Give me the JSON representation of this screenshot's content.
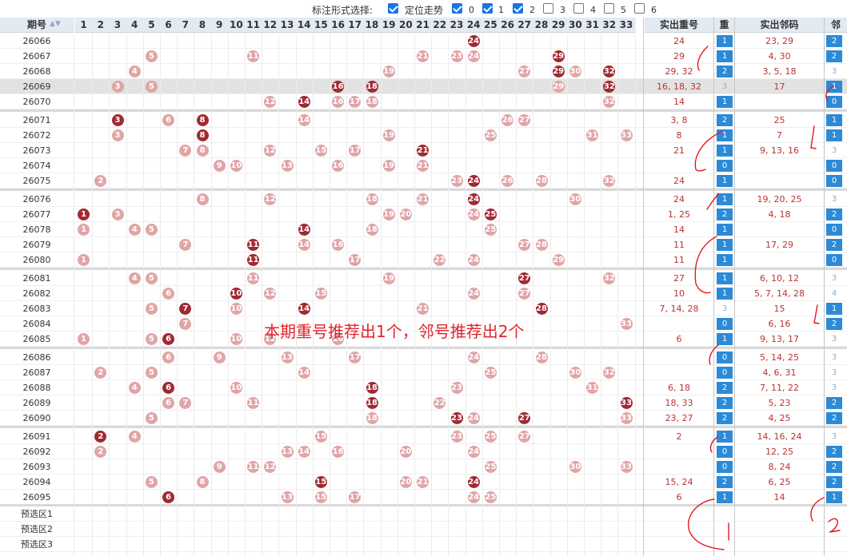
{
  "options": {
    "label": "标注形式选择:",
    "items": [
      {
        "label": "定位走势",
        "checked": true
      },
      {
        "label": "0",
        "checked": true
      },
      {
        "label": "1",
        "checked": true
      },
      {
        "label": "2",
        "checked": true
      },
      {
        "label": "3",
        "checked": false
      },
      {
        "label": "4",
        "checked": false
      },
      {
        "label": "5",
        "checked": false
      },
      {
        "label": "6",
        "checked": false
      }
    ]
  },
  "table": {
    "headers": {
      "period": "期号",
      "repeat_nums": "实出重号",
      "repeat": "重",
      "neighbor_nums": "实出邻码",
      "neighbor": "邻"
    },
    "numbers": [
      "1",
      "2",
      "3",
      "4",
      "5",
      "6",
      "7",
      "8",
      "9",
      "10",
      "11",
      "12",
      "13",
      "14",
      "15",
      "16",
      "17",
      "18",
      "19",
      "20",
      "21",
      "22",
      "23",
      "24",
      "25",
      "26",
      "27",
      "28",
      "29",
      "30",
      "31",
      "32",
      "33"
    ],
    "rows": [
      {
        "period": "26066",
        "dark": [
          24
        ],
        "light": [],
        "rep": "24",
        "r": "1",
        "rh": true,
        "nb": "23, 29",
        "n": "2",
        "nh": true
      },
      {
        "period": "26067",
        "dark": [
          29
        ],
        "light": [
          5,
          11,
          21,
          23,
          24
        ],
        "rep": "29",
        "r": "1",
        "rh": true,
        "nb": "4, 30",
        "n": "2",
        "nh": true
      },
      {
        "period": "26068",
        "dark": [
          29,
          32
        ],
        "light": [
          4,
          19,
          27,
          30
        ],
        "rep": "29, 32",
        "r": "2",
        "rh": true,
        "nb": "3, 5, 18",
        "n": "3",
        "nh": false
      },
      {
        "period": "26069",
        "dark": [
          16,
          18,
          32
        ],
        "light": [
          3,
          5,
          29
        ],
        "rep": "16, 18, 32",
        "r": "3",
        "rh": false,
        "nb": "17",
        "n": "1",
        "nh": true
      },
      {
        "period": "26070",
        "dark": [
          14
        ],
        "light": [
          12,
          16,
          17,
          18,
          32
        ],
        "rep": "14",
        "r": "1",
        "rh": true,
        "nb": "",
        "n": "0",
        "nh": true
      },
      {
        "period": "26071",
        "dark": [
          3,
          8
        ],
        "light": [
          6,
          14,
          26,
          27
        ],
        "rep": "3, 8",
        "r": "2",
        "rh": true,
        "nb": "25",
        "n": "1",
        "nh": true
      },
      {
        "period": "26072",
        "dark": [
          8
        ],
        "light": [
          3,
          19,
          25,
          31,
          33
        ],
        "rep": "8",
        "r": "1",
        "rh": true,
        "nb": "7",
        "n": "1",
        "nh": true
      },
      {
        "period": "26073",
        "dark": [
          21
        ],
        "light": [
          7,
          8,
          12,
          15,
          17
        ],
        "rep": "21",
        "r": "1",
        "rh": true,
        "nb": "9, 13, 16",
        "n": "3",
        "nh": false
      },
      {
        "period": "26074",
        "dark": [],
        "light": [
          9,
          10,
          13,
          16,
          19,
          21
        ],
        "rep": "",
        "r": "0",
        "rh": true,
        "nb": "",
        "n": "0",
        "nh": true
      },
      {
        "period": "26075",
        "dark": [
          24
        ],
        "light": [
          2,
          23,
          26,
          28,
          32
        ],
        "rep": "24",
        "r": "1",
        "rh": true,
        "nb": "",
        "n": "0",
        "nh": true
      },
      {
        "period": "26076",
        "dark": [
          24
        ],
        "light": [
          8,
          12,
          18,
          21,
          30
        ],
        "rep": "24",
        "r": "1",
        "rh": true,
        "nb": "19, 20, 25",
        "n": "3",
        "nh": false
      },
      {
        "period": "26077",
        "dark": [
          1,
          25
        ],
        "light": [
          3,
          19,
          20,
          24
        ],
        "rep": "1, 25",
        "r": "2",
        "rh": true,
        "nb": "4, 18",
        "n": "2",
        "nh": true
      },
      {
        "period": "26078",
        "dark": [
          14
        ],
        "light": [
          1,
          4,
          5,
          18,
          25
        ],
        "rep": "14",
        "r": "1",
        "rh": true,
        "nb": "",
        "n": "0",
        "nh": true
      },
      {
        "period": "26079",
        "dark": [
          11
        ],
        "light": [
          7,
          14,
          16,
          27,
          28
        ],
        "rep": "11",
        "r": "1",
        "rh": true,
        "nb": "17, 29",
        "n": "2",
        "nh": true
      },
      {
        "period": "26080",
        "dark": [
          11
        ],
        "light": [
          1,
          17,
          22,
          24,
          29
        ],
        "rep": "11",
        "r": "1",
        "rh": true,
        "nb": "",
        "n": "0",
        "nh": true
      },
      {
        "period": "26081",
        "dark": [
          27
        ],
        "light": [
          4,
          5,
          11,
          19,
          32
        ],
        "rep": "27",
        "r": "1",
        "rh": true,
        "nb": "6, 10, 12",
        "n": "3",
        "nh": false
      },
      {
        "period": "26082",
        "dark": [
          10
        ],
        "light": [
          6,
          12,
          15,
          24,
          27
        ],
        "rep": "10",
        "r": "1",
        "rh": true,
        "nb": "5, 7, 14, 28",
        "n": "4",
        "nh": false
      },
      {
        "period": "26083",
        "dark": [
          7,
          14,
          28
        ],
        "light": [
          5,
          10,
          21
        ],
        "rep": "7, 14, 28",
        "r": "3",
        "rh": false,
        "nb": "15",
        "n": "1",
        "nh": true
      },
      {
        "period": "26084",
        "dark": [],
        "light": [
          7,
          33
        ],
        "rep": "",
        "r": "0",
        "rh": true,
        "nb": "6, 16",
        "n": "2",
        "nh": true
      },
      {
        "period": "26085",
        "dark": [
          6
        ],
        "light": [
          1,
          5,
          10,
          12,
          16
        ],
        "rep": "6",
        "r": "1",
        "rh": true,
        "nb": "9, 13, 17",
        "n": "3",
        "nh": false
      },
      {
        "period": "26086",
        "dark": [],
        "light": [
          6,
          9,
          13,
          17,
          24,
          28
        ],
        "rep": "",
        "r": "0",
        "rh": true,
        "nb": "5, 14, 25",
        "n": "3",
        "nh": false
      },
      {
        "period": "26087",
        "dark": [],
        "light": [
          2,
          5,
          14,
          25,
          30,
          32
        ],
        "rep": "",
        "r": "0",
        "rh": true,
        "nb": "4, 6, 31",
        "n": "3",
        "nh": false
      },
      {
        "period": "26088",
        "dark": [
          6,
          18
        ],
        "light": [
          4,
          10,
          23,
          31
        ],
        "rep": "6, 18",
        "r": "2",
        "rh": true,
        "nb": "7, 11, 22",
        "n": "3",
        "nh": false
      },
      {
        "period": "26089",
        "dark": [
          18,
          33
        ],
        "light": [
          6,
          7,
          11,
          22
        ],
        "rep": "18, 33",
        "r": "2",
        "rh": true,
        "nb": "5, 23",
        "n": "2",
        "nh": true
      },
      {
        "period": "26090",
        "dark": [
          23,
          27
        ],
        "light": [
          5,
          18,
          24,
          33
        ],
        "rep": "23, 27",
        "r": "2",
        "rh": true,
        "nb": "4, 25",
        "n": "2",
        "nh": true
      },
      {
        "period": "26091",
        "dark": [
          2
        ],
        "light": [
          4,
          15,
          23,
          25,
          27
        ],
        "rep": "2",
        "r": "1",
        "rh": true,
        "nb": "14, 16, 24",
        "n": "3",
        "nh": false
      },
      {
        "period": "26092",
        "dark": [],
        "light": [
          2,
          13,
          14,
          16,
          20,
          24
        ],
        "rep": "",
        "r": "0",
        "rh": true,
        "nb": "12, 25",
        "n": "2",
        "nh": true
      },
      {
        "period": "26093",
        "dark": [],
        "light": [
          9,
          11,
          12,
          25,
          30,
          33
        ],
        "rep": "",
        "r": "0",
        "rh": true,
        "nb": "8, 24",
        "n": "2",
        "nh": true
      },
      {
        "period": "26094",
        "dark": [
          15,
          24
        ],
        "light": [
          5,
          8,
          20,
          21
        ],
        "rep": "15, 24",
        "r": "2",
        "rh": true,
        "nb": "6, 25",
        "n": "2",
        "nh": true
      },
      {
        "period": "26095",
        "dark": [
          6
        ],
        "light": [
          13,
          15,
          17,
          24,
          25
        ],
        "rep": "6",
        "r": "1",
        "rh": true,
        "nb": "14",
        "n": "1",
        "nh": true
      }
    ],
    "preselect": [
      "预选区1",
      "预选区2",
      "预选区3"
    ]
  },
  "annotation": "本期重号推荐出1个，邻号推荐出2个",
  "colors": {
    "dark_ball": "#a02a33",
    "light_ball": "#e0a5a7",
    "badge": "#2c8ad6",
    "header_bg": "#e2eaf3",
    "annotation": "#e2232a"
  }
}
